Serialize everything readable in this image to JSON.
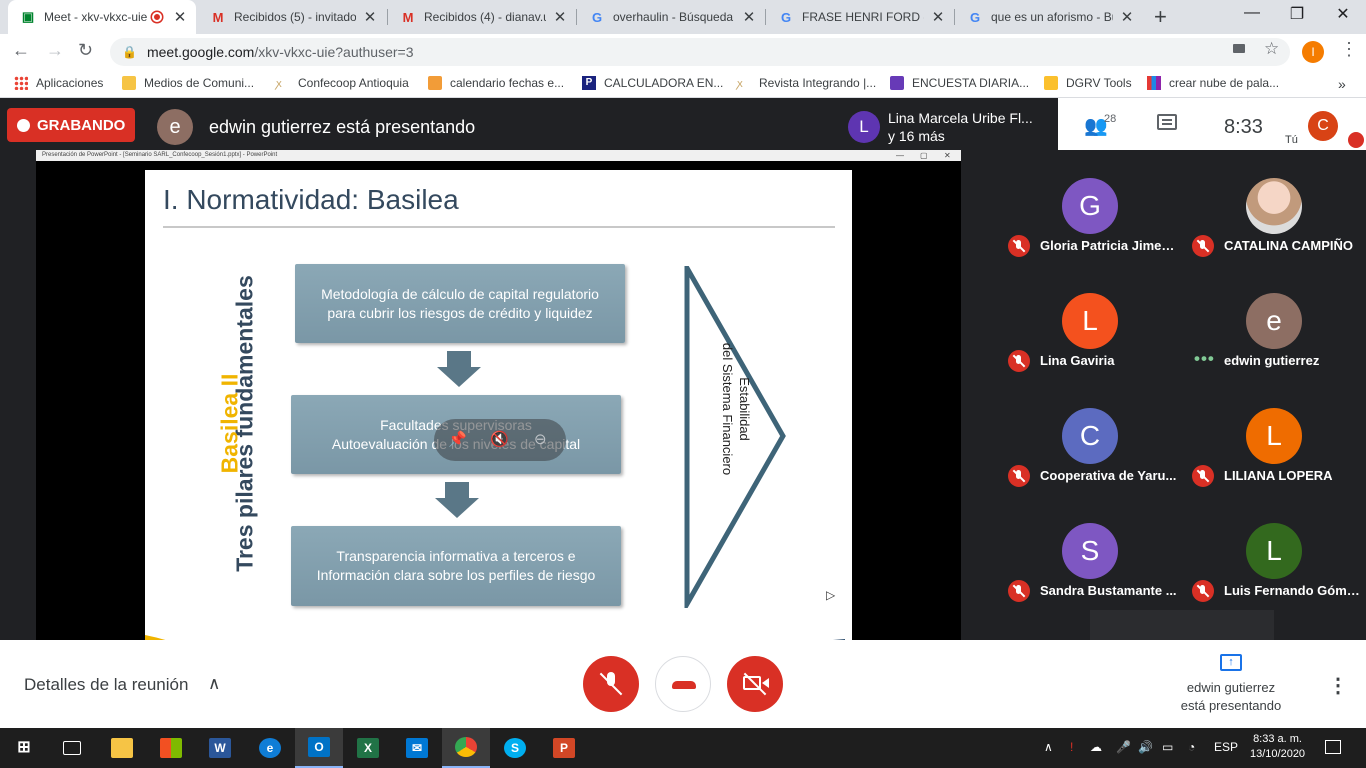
{
  "browser": {
    "tabs": [
      {
        "title": "Meet - xkv-vkxc-uie",
        "favicon": "meet-icon",
        "active": true
      },
      {
        "title": "Recibidos (5) - invitado",
        "favicon": "gmail-icon"
      },
      {
        "title": "Recibidos (4) - dianav.u",
        "favicon": "gmail-icon"
      },
      {
        "title": "overhaulin - Búsqueda",
        "favicon": "google-icon"
      },
      {
        "title": "FRASE HENRI FORD - B",
        "favicon": "google-icon"
      },
      {
        "title": "que es un aforismo - Bu",
        "favicon": "google-icon"
      }
    ],
    "new_tab": "+",
    "window_controls": {
      "minimize": "—",
      "maximize": "❐",
      "close": "✕"
    },
    "url_host": "meet.google.com",
    "url_path": "/xkv-vkxc-uie?authuser=3",
    "profile_initial": "I",
    "bookmarks": [
      {
        "label": "Aplicaciones",
        "icon": "apps-grid-icon"
      },
      {
        "label": "Medios de Comuni...",
        "icon": "folder-icon"
      },
      {
        "label": "Confecoop Antioquia",
        "icon": "site-icon"
      },
      {
        "label": "calendario fechas e...",
        "icon": "calendar-icon"
      },
      {
        "label": "CALCULADORA EN...",
        "icon": "p-icon"
      },
      {
        "label": "Revista Integrando |...",
        "icon": "site-icon"
      },
      {
        "label": "ENCUESTA DIARIA...",
        "icon": "forms-icon"
      },
      {
        "label": "DGRV Tools",
        "icon": "note-icon"
      },
      {
        "label": "crear nube de pala...",
        "icon": "chart-icon"
      }
    ],
    "more_bookmarks": "»"
  },
  "meet": {
    "recording_label": "GRABANDO",
    "presenter_initial": "e",
    "presenter_text": "edwin gutierrez está presentando",
    "others": {
      "initial": "L",
      "line1": "Lina Marcela Uribe Fl...",
      "line2": "y 16 más"
    },
    "participant_count": "28",
    "time": "8:33",
    "you_label": "Tú",
    "self_initial": "C",
    "ppt_window_title": "Presentación de PowerPoint - [Seminario SARL_Confecoop_Sesión1.pptx] - PowerPoint",
    "slide": {
      "title": "I.   Normatividad: Basilea",
      "vertical_main": "Tres pilares fundamentales",
      "vertical_accent": "Basilea  II",
      "box1_line1": "Metodología de cálculo de capital regulatorio",
      "box1_line2": "para cubrir los riesgos de crédito y liquidez",
      "box2_line1": "Facultades supervisoras",
      "box2_line2": "Autoevaluación de los niveles de capital",
      "box3_line1": "Transparencia informativa a terceros e",
      "box3_line2": "Información clara sobre los perfiles de riesgo",
      "triangle_line1": "Estabilidad",
      "triangle_line2": "del Sistema Financiero"
    },
    "participants": [
      {
        "name": "Gloria Patricia Jimen...",
        "initial": "G",
        "color": "#7e57c2",
        "mic": "muted"
      },
      {
        "name": "CATALINA CAMPIÑO",
        "initial": "",
        "color": "#dcdcdc",
        "mic": "muted",
        "photo": true
      },
      {
        "name": "Lina Gaviria",
        "initial": "L",
        "color": "#f4511e",
        "mic": "muted"
      },
      {
        "name": "edwin gutierrez",
        "initial": "e",
        "color": "#8d6e63",
        "mic": "speaking"
      },
      {
        "name": "Cooperativa de Yaru...",
        "initial": "C",
        "color": "#5c6bc0",
        "mic": "muted"
      },
      {
        "name": "LILIANA LOPERA",
        "initial": "L",
        "color": "#ef6c00",
        "mic": "muted"
      },
      {
        "name": "Sandra Bustamante ...",
        "initial": "S",
        "color": "#7e57c2",
        "mic": "muted"
      },
      {
        "name": "Luis Fernando Góme...",
        "initial": "L",
        "color": "#33691e",
        "mic": "muted"
      }
    ],
    "bottom": {
      "details_label": "Detalles de la reunión",
      "presenting_line1": "edwin gutierrez",
      "presenting_line2": "está presentando"
    }
  },
  "taskbar": {
    "apps": [
      "start-icon",
      "task-view-icon",
      "file-explorer-icon",
      "store-icon",
      "word-icon",
      "edge-icon",
      "outlook-icon",
      "excel-icon",
      "mail-icon",
      "chrome-icon",
      "skype-icon",
      "powerpoint-icon"
    ],
    "language": "ESP",
    "clock_time": "8:33 a. m.",
    "clock_date": "13/10/2020"
  }
}
